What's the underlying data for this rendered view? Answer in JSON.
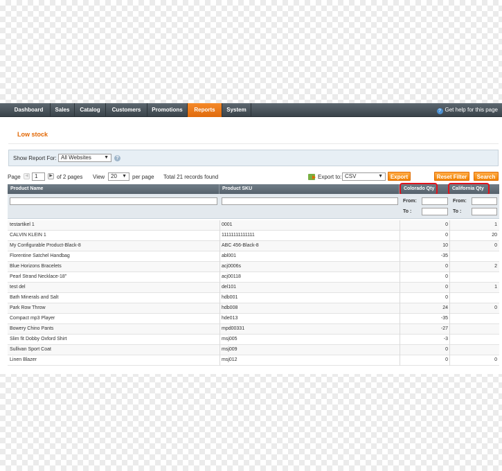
{
  "nav": {
    "items": [
      "Dashboard",
      "Sales",
      "Catalog",
      "Customers",
      "Promotions",
      "Reports",
      "System"
    ],
    "active_index": 5,
    "help_label": "Get help for this page"
  },
  "page": {
    "title": "Low stock"
  },
  "switcher": {
    "label": "Show Report For:",
    "selected": "All Websites"
  },
  "pager": {
    "page_label": "Page",
    "page_value": "1",
    "of_pages": "of 2 pages",
    "view_label": "View",
    "per_page_value": "20",
    "per_page_label": "per page",
    "total": "Total 21 records found",
    "export_label": "Export to:",
    "export_format": "CSV",
    "export_button": "Export",
    "reset_button": "Reset Filter",
    "search_button": "Search"
  },
  "grid": {
    "columns": [
      "Product Name",
      "Product SKU",
      "Colorado Qty",
      "California Qty"
    ],
    "filter_from": "From:",
    "filter_to": "To :",
    "rows": [
      {
        "name": "testartikel 1",
        "sku": "0001",
        "colorado": "0",
        "california": "1"
      },
      {
        "name": "CALVIN KLEIN 1",
        "sku": "11111111111111",
        "colorado": "0",
        "california": "20"
      },
      {
        "name": "My Configurable Product-Black-8",
        "sku": "ABC 456-Black-8",
        "colorado": "10",
        "california": "0"
      },
      {
        "name": "Florentine Satchel Handbag",
        "sku": "abl001",
        "colorado": "-35",
        "california": ""
      },
      {
        "name": "Blue Horizons Bracelets",
        "sku": "acj0006s",
        "colorado": "0",
        "california": "2"
      },
      {
        "name": "Pearl Strand Necklace-18\"",
        "sku": "acj00118",
        "colorado": "0",
        "california": ""
      },
      {
        "name": "test del",
        "sku": "del101",
        "colorado": "0",
        "california": "1"
      },
      {
        "name": "Bath Minerals and Salt",
        "sku": "hdb001",
        "colorado": "0",
        "california": ""
      },
      {
        "name": "Park Row Throw",
        "sku": "hdb008",
        "colorado": "24",
        "california": "0"
      },
      {
        "name": "Compact mp3 Player",
        "sku": "hde013",
        "colorado": "-35",
        "california": ""
      },
      {
        "name": "Bowery Chino Pants",
        "sku": "mpd00331",
        "colorado": "-27",
        "california": ""
      },
      {
        "name": "Slim fit Dobby Oxford Shirt",
        "sku": "msj005",
        "colorado": "-3",
        "california": ""
      },
      {
        "name": "Sullivan Sport Coat",
        "sku": "msj009",
        "colorado": "0",
        "california": ""
      },
      {
        "name": "Linen Blazer",
        "sku": "msj012",
        "colorado": "0",
        "california": "0"
      }
    ]
  },
  "colors": {
    "accent": "#e26703",
    "nav": "#4a545c",
    "highlight": "#e0121b"
  },
  "icons": {
    "help": "help-circle-icon",
    "info": "info-icon",
    "export": "export-icon"
  }
}
